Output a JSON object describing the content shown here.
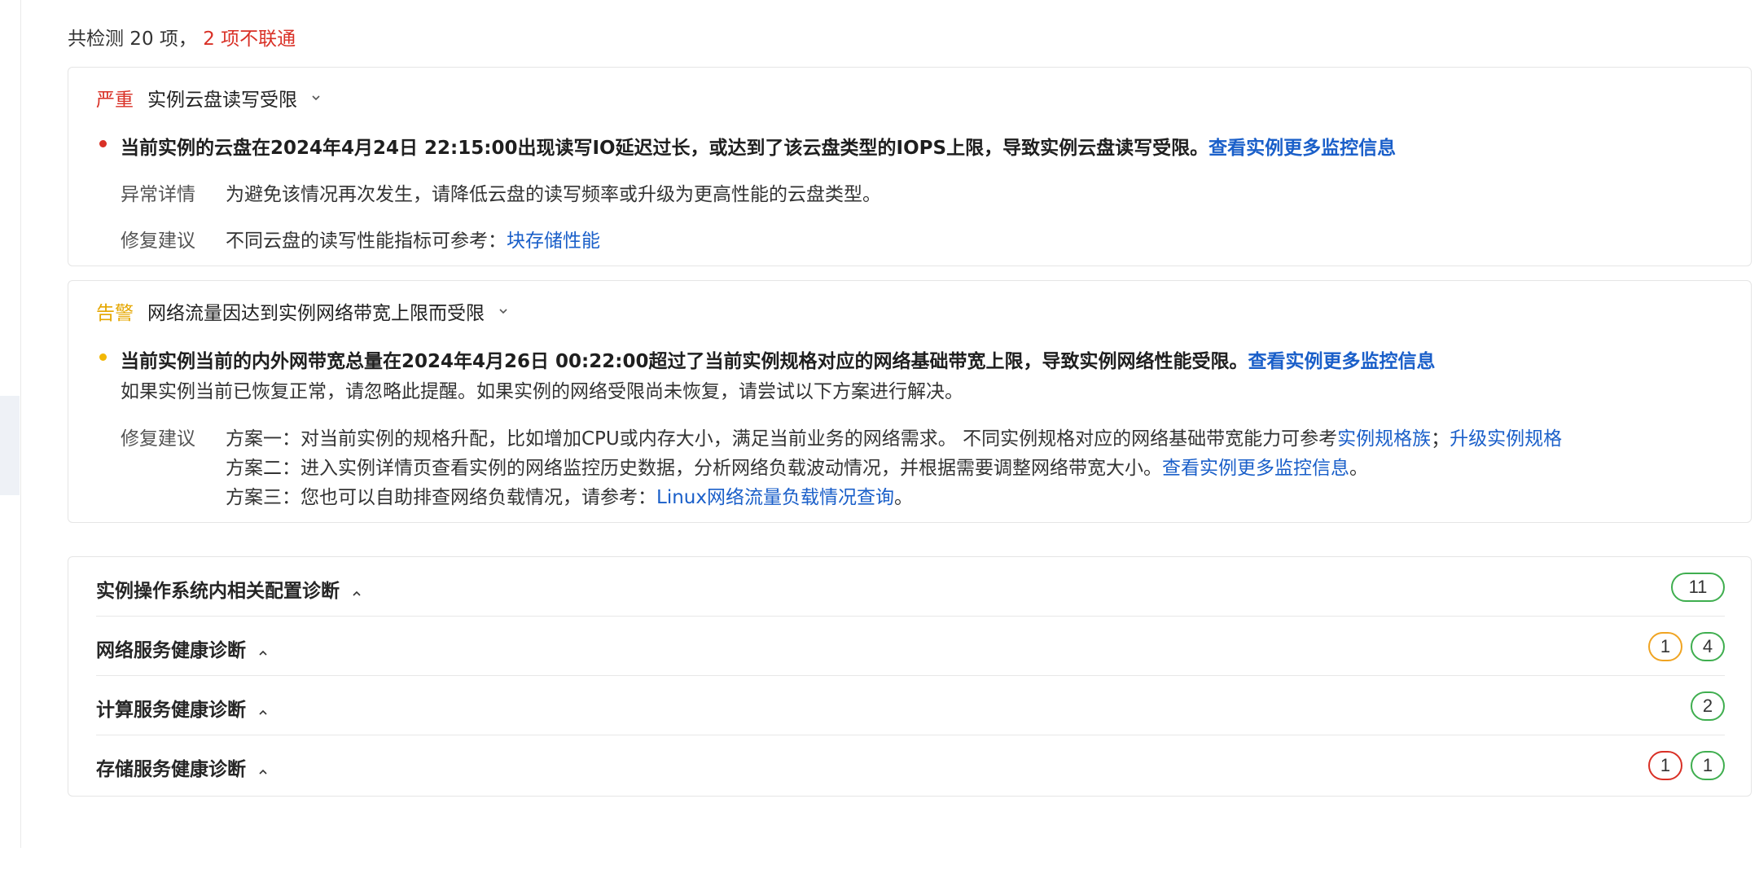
{
  "summary": {
    "total": "共检测 20 项，",
    "failed": "2 项不联通"
  },
  "alerts": [
    {
      "severity": "严重",
      "title": "实例云盘读写受限",
      "message": "当前实例的云盘在2024年4月24日 22:15:00出现读写IO延迟过长，或达到了该云盘类型的IOPS上限，导致实例云盘读写受限。",
      "message_link": "查看实例更多监控信息",
      "detail_key": "异常详情",
      "detail_value": "为避免该情况再次发生，请降低云盘的读写频率或升级为更高性能的云盘类型。",
      "fix_key": "修复建议",
      "fix_value": "不同云盘的读写性能指标可参考：",
      "fix_link": "块存储性能"
    },
    {
      "severity": "告警",
      "title": "网络流量因达到实例网络带宽上限而受限",
      "message": "当前实例当前的内外网带宽总量在2024年4月26日 00:22:00超过了当前实例规格对应的网络基础带宽上限，导致实例网络性能受限。",
      "message_link": "查看实例更多监控信息",
      "message_line2": "如果实例当前已恢复正常，请忽略此提醒。如果实例的网络受限尚未恢复，请尝试以下方案进行解决。",
      "fix_key": "修复建议",
      "plan1_text": "方案一：对当前实例的规格升配，比如增加CPU或内存大小，满足当前业务的网络需求。 不同实例规格对应的网络基础带宽能力可参考",
      "plan1_link1": "实例规格族",
      "plan1_sep": "；",
      "plan1_link2": "升级实例规格",
      "plan2_text": "方案二：进入实例详情页查看实例的网络监控历史数据，分析网络负载波动情况，并根据需要调整网络带宽大小。",
      "plan2_link": "查看实例更多监控信息",
      "plan2_end": "。",
      "plan3_text": "方案三：您也可以自助排查网络负载情况，请参考：",
      "plan3_link": "Linux网络流量负载情况查询",
      "plan3_end": "。"
    }
  ],
  "groups": [
    {
      "label": "实例操作系统内相关配置诊断",
      "badges": [
        {
          "value": "11",
          "status": "green"
        }
      ]
    },
    {
      "label": "网络服务健康诊断",
      "badges": [
        {
          "value": "1",
          "status": "orange"
        },
        {
          "value": "4",
          "status": "green"
        }
      ]
    },
    {
      "label": "计算服务健康诊断",
      "badges": [
        {
          "value": "2",
          "status": "green"
        }
      ]
    },
    {
      "label": "存储服务健康诊断",
      "badges": [
        {
          "value": "1",
          "status": "red"
        },
        {
          "value": "1",
          "status": "green"
        }
      ]
    }
  ],
  "icons": {
    "expand": "chevron-down-icon",
    "collapse": "chevron-up-icon"
  },
  "colors": {
    "critical": "#d93026",
    "warning": "#e5a700",
    "link": "#1a5fc9",
    "ok": "#3fae4f"
  }
}
